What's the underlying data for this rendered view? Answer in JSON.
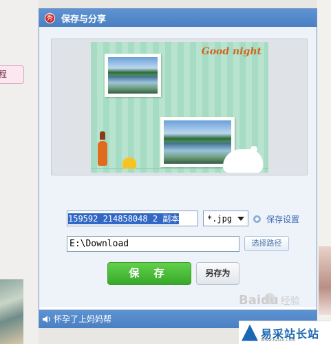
{
  "background": {
    "side_tab_label": "程"
  },
  "dialog": {
    "title": "保存与分享",
    "logo_text": "秀",
    "preview": {
      "card_text": "Good night"
    },
    "filename_value": "159592 214858048 2 副本",
    "format_selected": "*.jpg",
    "settings_link": "保存设置",
    "path_value": "E:\\Download",
    "choose_path_button": "选择路径",
    "save_button": "保 存",
    "save_as_button": "另存为",
    "status_text": "怀孕了上妈妈帮"
  },
  "watermarks": {
    "baidu": "Bai",
    "baidu_suffix": "du",
    "baidu_jingyan": "经验",
    "site_name": "易采站长站",
    "site_url": "Www.Easck.Com"
  }
}
